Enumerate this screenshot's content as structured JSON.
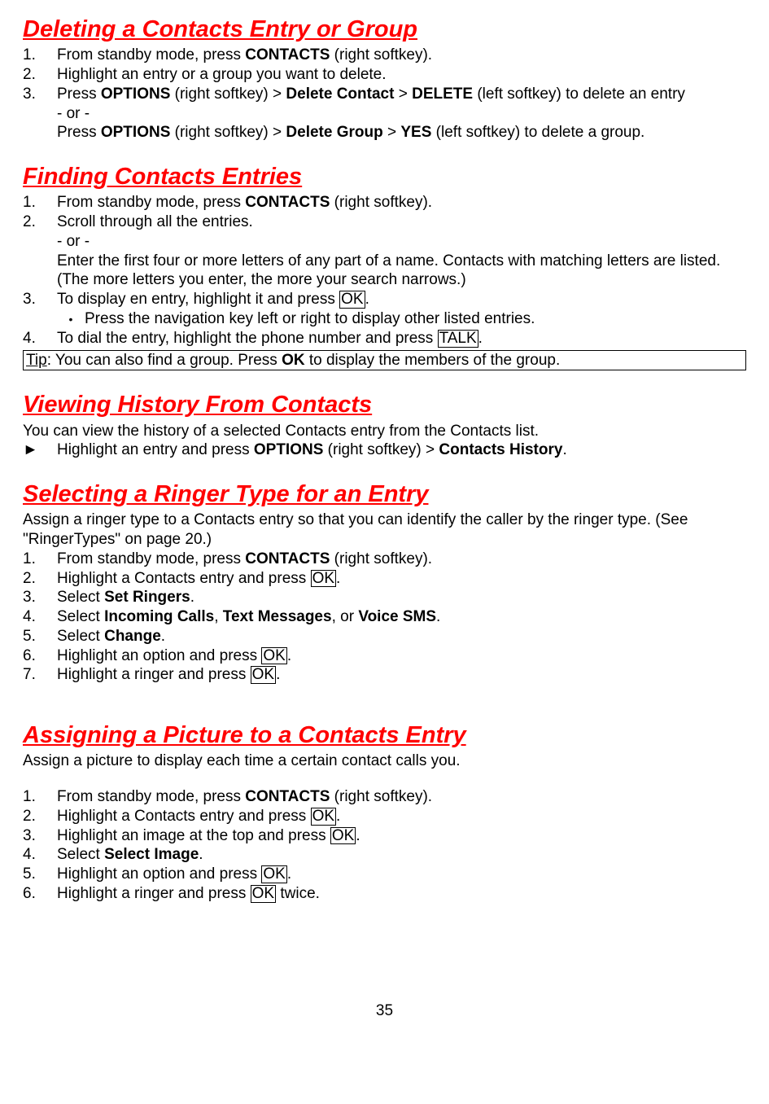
{
  "sections": {
    "deleting": {
      "title": "Deleting a Contacts Entry or Group",
      "steps": {
        "s1_num": "1.",
        "s1_a": "From standby mode, press ",
        "s1_b": "CONTACTS",
        "s1_c": " (right softkey).",
        "s2_num": "2.",
        "s2": "Highlight an entry or a group you want to delete.",
        "s3_num": "3.",
        "s3_a": "Press ",
        "s3_b": "OPTIONS",
        "s3_c": " (right softkey) > ",
        "s3_d": "Delete Contact",
        "s3_e": " > ",
        "s3_f": "DELETE",
        "s3_g": " (left softkey) to delete an entry",
        "s3_h": "- or -",
        "s3_i": "Press ",
        "s3_j": "OPTIONS",
        "s3_k": " (right softkey) > ",
        "s3_l": "Delete Group",
        "s3_m": " > ",
        "s3_n": "YES",
        "s3_o": " (left softkey) to delete a group."
      }
    },
    "finding": {
      "title": "Finding Contacts Entries",
      "steps": {
        "s1_num": "1.",
        "s1_a": "From standby mode, press ",
        "s1_b": "CONTACTS",
        "s1_c": " (right softkey).",
        "s2_num": "2.",
        "s2_a": "Scroll through all the entries.",
        "s2_b": "- or -",
        "s2_c": "Enter the first four or more letters of any part of a name. Contacts with matching letters are listed. (The more letters you enter, the more your search narrows.)",
        "s3_num": "3.",
        "s3_a": "To display en entry, highlight it and press ",
        "s3_b": "OK",
        "s3_c": ".",
        "bullet_sym": "•",
        "bullet": "Press the navigation key left or right to display other listed entries.",
        "s4_num": "4.",
        "s4_a": "To dial the entry, highlight the phone number and press ",
        "s4_b": "TALK",
        "s4_c": "."
      },
      "tip_a": "Tip",
      "tip_b": ": You can also find a group. Press ",
      "tip_c": "OK",
      "tip_d": " to display the members of the group."
    },
    "history": {
      "title": "Viewing History From Contacts",
      "intro": "You can view the history of a selected Contacts entry from the Contacts list.",
      "arrow": "►",
      "line_a": "Highlight an entry and press ",
      "line_b": "OPTIONS",
      "line_c": " (right softkey) > ",
      "line_d": "Contacts History",
      "line_e": "."
    },
    "ringer": {
      "title": "Selecting a Ringer Type for an Entry",
      "intro": "Assign a ringer type to a Contacts entry so that you can identify the caller by the ringer type. (See \"RingerTypes\" on page 20.)",
      "steps": {
        "s1_num": "1.",
        "s1_a": "From standby mode, press ",
        "s1_b": "CONTACTS",
        "s1_c": " (right softkey).",
        "s2_num": "2.",
        "s2_a": "Highlight a Contacts entry and press ",
        "s2_b": "OK",
        "s2_c": ".",
        "s3_num": "3.",
        "s3_a": "Select ",
        "s3_b": "Set Ringers",
        "s3_c": ".",
        "s4_num": "4.",
        "s4_a": "Select ",
        "s4_b": "Incoming Calls",
        "s4_c": ", ",
        "s4_d": "Text Messages",
        "s4_e": ", or ",
        "s4_f": "Voice SMS",
        "s4_g": ".",
        "s5_num": "5.",
        "s5_a": "Select ",
        "s5_b": "Change",
        "s5_c": ".",
        "s6_num": "6.",
        "s6_a": "Highlight an option and press ",
        "s6_b": "OK",
        "s6_c": ".",
        "s7_num": "7.",
        "s7_a": "Highlight a ringer and press ",
        "s7_b": "OK",
        "s7_c": "."
      }
    },
    "picture": {
      "title": "Assigning a Picture to a Contacts Entry",
      "intro": "Assign a picture to display each time a certain contact calls you.",
      "steps": {
        "s1_num": "1.",
        "s1_a": "From standby mode, press ",
        "s1_b": "CONTACTS",
        "s1_c": " (right softkey).",
        "s2_num": "2.",
        "s2_a": "Highlight a Contacts entry and press ",
        "s2_b": "OK",
        "s2_c": ".",
        "s3_num": "3.",
        "s3_a": "Highlight an image at the top and press ",
        "s3_b": "OK",
        "s3_c": ".",
        "s4_num": "4.",
        "s4_a": "Select ",
        "s4_b": "Select Image",
        "s4_c": ".",
        "s5_num": "5.",
        "s5_a": "Highlight an option and press ",
        "s5_b": "OK",
        "s5_c": ".",
        "s6_num": "6.",
        "s6_a": "Highlight a ringer and press ",
        "s6_b": "OK",
        "s6_c": " twice."
      }
    }
  },
  "page_number": "35"
}
